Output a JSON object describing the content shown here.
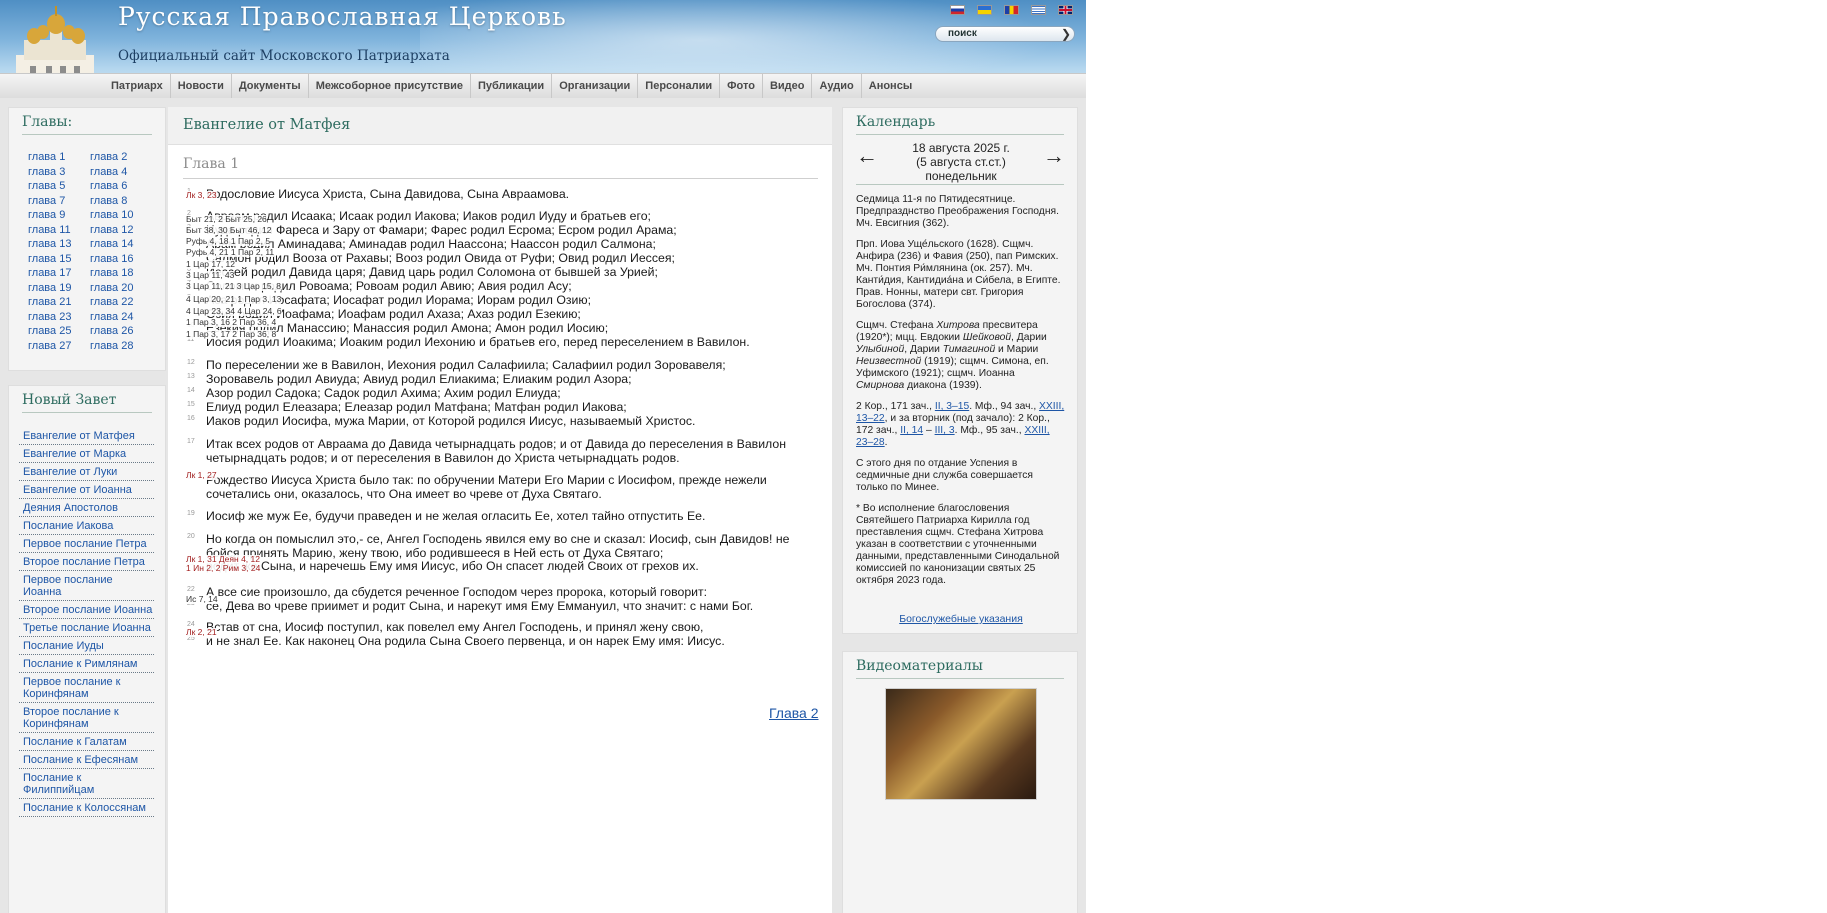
{
  "header": {
    "title": "Русская Православная Церковь",
    "subtitle": "Официальный сайт Московского Патриархата",
    "search_placeholder": "поиск",
    "flags": [
      "ru",
      "ua",
      "md",
      "gr",
      "en"
    ]
  },
  "topnav": [
    "Патриарх",
    "Новости",
    "Документы",
    "Межсоборное присутствие",
    "Публикации",
    "Организации",
    "Персоналии",
    "Фото",
    "Видео",
    "Аудио",
    "Анонсы"
  ],
  "chapters": {
    "title": "Главы:",
    "items": [
      "глава 1",
      "глава 2",
      "глава 3",
      "глава 4",
      "глава 5",
      "глава 6",
      "глава 7",
      "глава 8",
      "глава 9",
      "глава 10",
      "глава 11",
      "глава 12",
      "глава 13",
      "глава 14",
      "глава 15",
      "глава 16",
      "глава 17",
      "глава 18",
      "глава 19",
      "глава 20",
      "глава 21",
      "глава 22",
      "глава 23",
      "глава 24",
      "глава 25",
      "глава 26",
      "глава 27",
      "глава 28"
    ]
  },
  "new_testament": {
    "title": "Новый Завет",
    "books": [
      "Евангелие от Матфея",
      "Евангелие от Марка",
      "Евангелие от Луки",
      "Евангелие от Иоанна",
      "Деяния Апостолов",
      "Послание Иакова",
      "Первое послание Петра",
      "Второе послание Петра",
      "Первое послание Иоанна",
      "Второе послание Иоанна",
      "Третье послание Иоанна",
      "Послание Иуды",
      "Послание к Римлянам",
      "Первое послание к Коринфянам",
      "Второе послание к Коринфянам",
      "Послание к Галатам",
      "Послание к Ефесянам",
      "Послание к Филиппийцам",
      "Послание к Колоссянам"
    ]
  },
  "main": {
    "book_title": "Евангелие от Матфея",
    "chapter_title": "Глава 1",
    "next_chapter": "Глава 2",
    "verses": [
      {
        "n": "1",
        "t": "Родословие Иисуса Христа, Сына Давидова, Сына Авраамова."
      },
      {
        "n": "2",
        "t": "Авраам родил Исаака; Исаак родил Иакова; Иаков родил Иуду и братьев его;"
      },
      {
        "n": "3",
        "t": "Иуда родил Фареса и Зару от Фамари; Фарес родил Есрома; Есром родил Арама;"
      },
      {
        "n": "4",
        "t": "Арам родил Аминадава; Аминадав родил Наассона; Наассон родил Салмона;"
      },
      {
        "n": "5",
        "t": "Салмон родил Вооза от Рахавы; Вооз родил Овида от Руфи; Овид родил Иессея;"
      },
      {
        "n": "6",
        "t": "Иессей родил Давида царя; Давид царь родил Соломона от бывшей за Урией;"
      },
      {
        "n": "7",
        "t": "Соломон родил Ровоама; Ровоам родил Авию; Авия родил Асу;"
      },
      {
        "n": "8",
        "t": "Аса родил Иосафата; Иосафат родил Иорама; Иорам родил Озию;"
      },
      {
        "n": "9",
        "t": "Озия родил Иоафама; Иоафам родил Ахаза; Ахаз родил Езекию;"
      },
      {
        "n": "10",
        "t": "Езекия родил Манассию; Манассия родил Амона; Амон родил Иосию;"
      },
      {
        "n": "11",
        "t": "Иосия родил Иоакима; Иоаким родил Иехонию и братьев его, перед переселением в Вавилон."
      },
      {
        "n": "12",
        "t": "По переселении же в Вавилон, Иехония родил Салафиила; Салафиил родил Зоровавеля;"
      },
      {
        "n": "13",
        "t": "Зоровавель родил Авиуда; Авиуд родил Елиакима; Елиаким родил Азора;"
      },
      {
        "n": "14",
        "t": "Азор родил Садока; Садок родил Ахима; Ахим родил Елиуда;"
      },
      {
        "n": "15",
        "t": "Елиуд родил Елеазара; Елеазар родил Матфана; Матфан родил Иакова;"
      },
      {
        "n": "16",
        "t": "Иаков родил Иосифа, мужа Марии, от Которой родился Иисус, называемый Христос."
      },
      {
        "n": "17",
        "t": "Итак всех родов от Авраама до Давида четырнадцать родов; и от Давида до переселения в Вавилон четырнадцать родов; и от переселения в Вавилон до Христа четырнадцать родов."
      },
      {
        "n": "18",
        "t": "Рождество Иисуса Христа было так: по обручении Матери Его Марии с Иосифом, прежде нежели сочетались они, оказалось, что Она имеет во чреве от Духа Святаго."
      },
      {
        "n": "19",
        "t": "Иосиф же муж Ее, будучи праведен и не желая огласить Ее, хотел тайно отпустить Ее."
      },
      {
        "n": "20",
        "t": "Но когда он помыслил это,- се, Ангел Господень явился ему во сне и сказал: Иосиф, сын Давидов! не бойся принять Марию, жену твою, ибо родившееся в Ней есть от Духа Святаго;"
      },
      {
        "n": "21",
        "t": "родит же Сына, и наречешь Ему имя Иисус, ибо Он спасет людей Своих от грехов их."
      },
      {
        "n": "22",
        "t": "А все сие произошло, да сбудется реченное Господом через пророка, который говорит:"
      },
      {
        "n": "23",
        "t": "се, Дева во чреве приимет и родит Сына, и нарекут имя Ему Еммануил, что значит: с нами Бог."
      },
      {
        "n": "24",
        "t": "Встав от сна, Иосиф поступил, как повелел ему Ангел Господень, и принял жену свою,"
      },
      {
        "n": "25",
        "t": "и не знал Ее. Как наконец Она родила Сына Своего первенца, и он нарек Ему имя: Иисус."
      }
    ],
    "xrefs": [
      {
        "t": "Лк 3, 23",
        "red": true
      },
      {
        "t": "Быт 21, 2 Быт 25, 26",
        "red": false
      },
      {
        "t": "Быт 38, 30 Быт 46, 12",
        "red": false
      },
      {
        "t": "Руфь 4, 18 1 Пар 2, 5",
        "red": false
      },
      {
        "t": "Руфь 4, 21 1 Пар 2, 11",
        "red": false
      },
      {
        "t": "1 Цар 17, 12",
        "red": false
      },
      {
        "t": "3 Цар 11, 43",
        "red": false
      },
      {
        "t": "3 Цар 11, 21 3 Цар 15, 8",
        "red": false
      },
      {
        "t": "4 Цар 20, 21 1 Пар 3, 13",
        "red": false
      },
      {
        "t": "4 Цар 23, 34 4 Цар 24, 6",
        "red": false
      },
      {
        "t": "1 Пар 3, 16 2 Пар 36, 4",
        "red": false
      },
      {
        "t": "1 Пар 3, 17 2 Пар 36, 8",
        "red": false
      },
      {
        "t": "Лк 1, 27",
        "red": true
      },
      {
        "t": "Лк 1, 31 Деян 4, 12",
        "red": true
      },
      {
        "t": "1 Ин 2, 2 Рим 3, 24",
        "red": true
      },
      {
        "t": "Ис 7, 14",
        "red": false
      },
      {
        "t": "Лк 2, 21",
        "red": true
      }
    ]
  },
  "calendar": {
    "title": "Календарь",
    "date_line1": "18 августа 2025 г.",
    "date_line2": "(5 августа ст.ст.)",
    "date_line3": "понедельник",
    "p1": "Седмица 11-я по Пятидесятнице. Предпразднство Преображения Господня. Мч. Евсигния (362).",
    "p2": "Прп. Иова Уще́льского (1628). Сщмч. Анфира (236) и Фавия (250), пап Римских. Мч. Понтия Ри́млянина (ок. 257). Мч. Канти́дия, Кантидиа́на и Си́бела, в Египте. Прав. Нонны, матери свт. Григория Богослова (374).",
    "p3_a": "Сщмч. Стефана ",
    "p3_b": "Хитрова",
    "p3_c": " пресвитера (1920*); мцц. Евдокии ",
    "p3_d": "Шейковой",
    "p3_e": ", Дарии ",
    "p3_f": "Улыбиной",
    "p3_g": ", Дарии ",
    "p3_h": "Тимагиной",
    "p3_i": " и Марии ",
    "p3_j": "Неизвестной",
    "p3_k": " (1919); сщмч. Симона, еп. Уфимского (1921); сщмч. Иоанна ",
    "p3_l": "Смирнова",
    "p3_m": " диакона (1939).",
    "r1": "2 Кор., 171 зач., ",
    "r2": "II, 3–15",
    "r3": ". Мф., 94 зач., ",
    "r4": "XXIII, 13–22",
    "r5": ", и за вторник (под зачало): 2 Кор., 172 зач., ",
    "r6": "II, 14",
    "r7": " – ",
    "r8": "III, 3",
    "r9": ". Мф., 95 зач., ",
    "r10": "XXIII, 23–28",
    "r11": ".",
    "p5": "С этого дня по отдание Успения в седмичные дни служба совершается только по Минее.",
    "p6": "* Во исполнение благословения Святейшего Патриарха Кирилла год преставления сщмч. Стефана Хитрова указан в соответствии с уточненными данными, представленными Синодальной комиссией по канонизации святых 25 октября 2023 года.",
    "link": "Богослужебные указания",
    "prev": "←",
    "next": "→"
  },
  "video": {
    "title": "Видеоматериалы"
  }
}
